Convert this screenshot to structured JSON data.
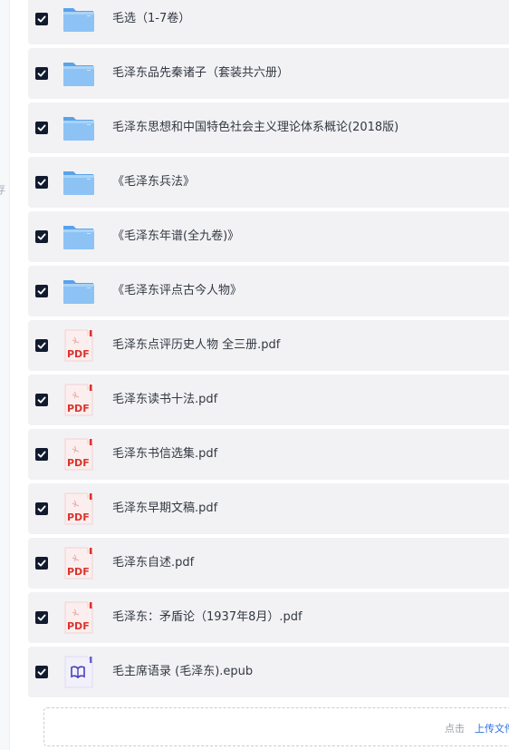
{
  "sidebar": {
    "edge_char": "存"
  },
  "files": [
    {
      "name": "毛选（1-7卷）",
      "type": "folder",
      "checked": true
    },
    {
      "name": "毛泽东品先秦诸子（套装共六册）",
      "type": "folder",
      "checked": true
    },
    {
      "name": "毛泽东思想和中国特色社会主义理论体系概论(2018版)",
      "type": "folder",
      "checked": true
    },
    {
      "name": "《毛泽东兵法》",
      "type": "folder",
      "checked": true
    },
    {
      "name": "《毛泽东年谱(全九卷)》",
      "type": "folder",
      "checked": true
    },
    {
      "name": "《毛泽东评点古今人物》",
      "type": "folder",
      "checked": true
    },
    {
      "name": "毛泽东点评历史人物 全三册.pdf",
      "type": "pdf",
      "checked": true
    },
    {
      "name": "毛泽东读书十法.pdf",
      "type": "pdf",
      "checked": true
    },
    {
      "name": "毛泽东书信选集.pdf",
      "type": "pdf",
      "checked": true
    },
    {
      "name": "毛泽东早期文稿.pdf",
      "type": "pdf",
      "checked": true
    },
    {
      "name": "毛泽东自述.pdf",
      "type": "pdf",
      "checked": true
    },
    {
      "name": "毛泽东：矛盾论（1937年8月）.pdf",
      "type": "pdf",
      "checked": true
    },
    {
      "name": "毛主席语录 (毛泽东).epub",
      "type": "epub",
      "checked": true
    }
  ],
  "icons": {
    "folder": "folder-icon",
    "pdf": "pdf-file-icon",
    "epub": "epub-book-icon",
    "pdf_label": "PDF"
  },
  "upload": {
    "hint": "点击",
    "link": "上传文件"
  },
  "colors": {
    "checkbox": "#121b2e",
    "row_bg": "#f2f2f4",
    "folder": "#7db8f0",
    "pdf_red": "#d9342b",
    "epub_accent": "#6b5fd3",
    "link": "#2f6fdc"
  }
}
